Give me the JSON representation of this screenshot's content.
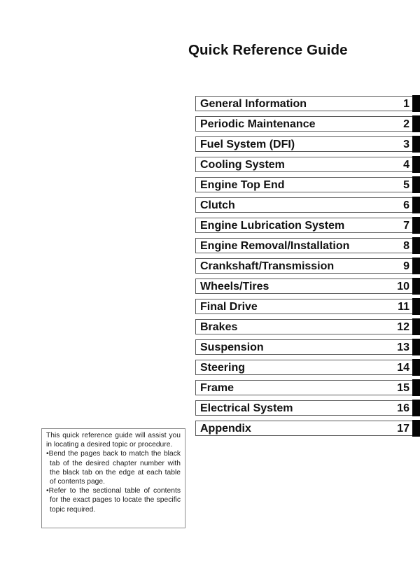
{
  "page": {
    "title": "Quick Reference Guide"
  },
  "toc": {
    "tab_color": "#050505",
    "items": [
      {
        "label": "General Information",
        "number": "1"
      },
      {
        "label": "Periodic Maintenance",
        "number": "2"
      },
      {
        "label": "Fuel System (DFI)",
        "number": "3"
      },
      {
        "label": "Cooling System",
        "number": "4"
      },
      {
        "label": "Engine Top End",
        "number": "5"
      },
      {
        "label": "Clutch",
        "number": "6"
      },
      {
        "label": "Engine Lubrication System",
        "number": "7"
      },
      {
        "label": "Engine Removal/Installation",
        "number": "8"
      },
      {
        "label": "Crankshaft/Transmission",
        "number": "9"
      },
      {
        "label": "Wheels/Tires",
        "number": "10"
      },
      {
        "label": "Final Drive",
        "number": "11"
      },
      {
        "label": "Brakes",
        "number": "12"
      },
      {
        "label": "Suspension",
        "number": "13"
      },
      {
        "label": "Steering",
        "number": "14"
      },
      {
        "label": "Frame",
        "number": "15"
      },
      {
        "label": "Electrical System",
        "number": "16"
      },
      {
        "label": "Appendix",
        "number": "17"
      }
    ]
  },
  "note": {
    "intro": "This quick reference guide will assist you in locating a desired topic or procedure.",
    "bullets": [
      "•Bend the pages back to match the black tab of the desired chapter number with the black tab on the edge at each table of contents page.",
      "•Refer to the sectional table of contents for the exact pages to locate the specific topic required."
    ]
  }
}
